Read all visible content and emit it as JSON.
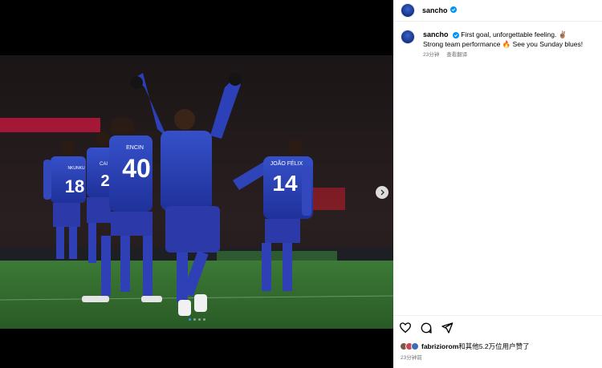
{
  "post": {
    "username": "sancho",
    "caption_line1": "First goal, unforgettable feeling. ✌🏽",
    "caption_line2": "Strong team performance 🔥 See you Sunday blues!",
    "caption_time": "23分钟",
    "translate_label": "查看翻译",
    "liked_by_user": "fabriziorom",
    "likes_suffix": "和其他5.2万位用户赞了",
    "post_time": "23分钟前"
  },
  "photo": {
    "jersey_numbers": [
      "18",
      "2",
      "40",
      "14"
    ],
    "jersey_names": [
      "NKUNKU",
      "CAI",
      "ENCIN",
      "JOÃO FÉLIX"
    ],
    "slide_count": 4,
    "active_slide": 1
  },
  "icons": {
    "verified": "verified-badge-icon",
    "like": "heart-icon",
    "comment": "comment-icon",
    "share": "send-icon",
    "next": "chevron-right-icon"
  },
  "colors": {
    "kit_blue": "#2a3fb0",
    "verified_blue": "#0095f6",
    "pitch_green": "#2f6b2e"
  }
}
